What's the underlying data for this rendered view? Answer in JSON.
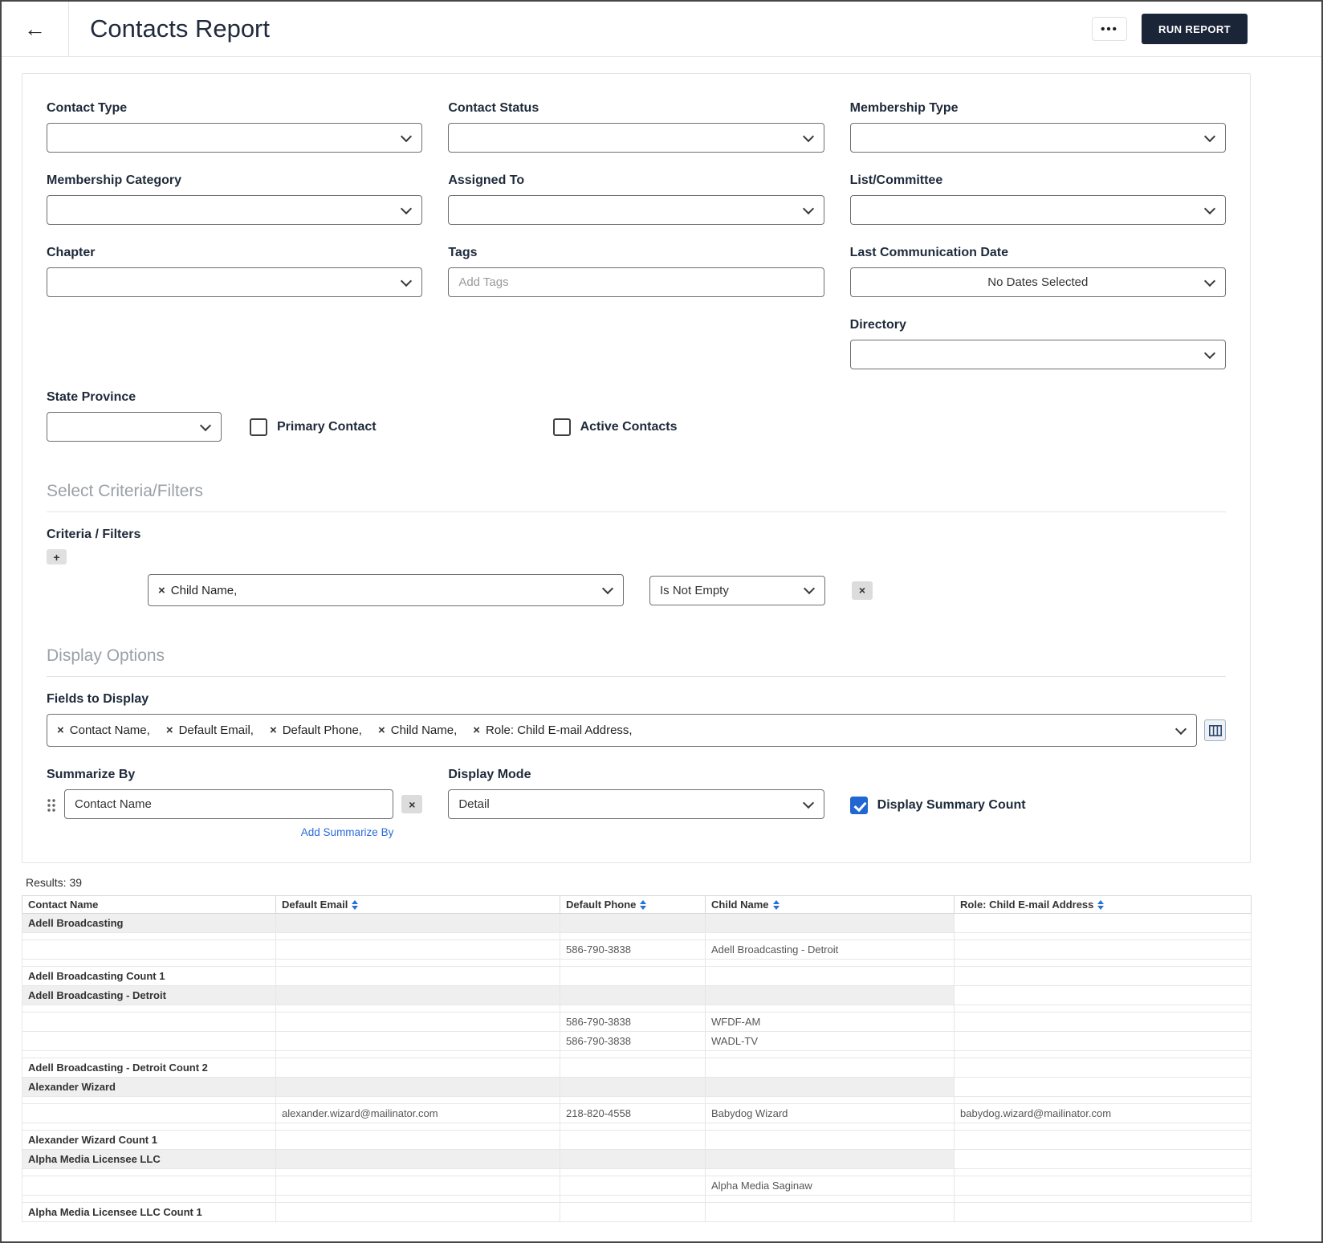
{
  "header": {
    "back_icon": "←",
    "title": "Contacts Report",
    "more_icon": "•••",
    "run_report_label": "RUN REPORT"
  },
  "icons": {
    "remove": "×"
  },
  "colors": {
    "accent_blue": "#2270d8",
    "run_button_bg": "#1b2538",
    "checkbox_checked": "#2166d1",
    "group_row_bg": "#efefef"
  },
  "filters": {
    "contact_type_label": "Contact Type",
    "contact_status_label": "Contact Status",
    "membership_type_label": "Membership Type",
    "membership_category_label": "Membership Category",
    "assigned_to_label": "Assigned To",
    "list_committee_label": "List/Committee",
    "chapter_label": "Chapter",
    "tags_label": "Tags",
    "tags_placeholder": "Add Tags",
    "last_communication_date_label": "Last Communication Date",
    "last_communication_date_value": "No Dates Selected",
    "directory_label": "Directory",
    "state_province_label": "State Province",
    "primary_contact_label": "Primary Contact",
    "primary_contact_checked": false,
    "active_contacts_label": "Active Contacts",
    "active_contacts_checked": false
  },
  "criteria": {
    "section_title": "Select Criteria/Filters",
    "label": "Criteria / Filters",
    "add_icon": "+",
    "row": {
      "field_token": "Child Name,",
      "operator": "Is Not Empty"
    }
  },
  "display_options": {
    "section_title": "Display Options",
    "fields_to_display_label": "Fields to Display",
    "field_tokens": [
      "Contact Name,",
      "Default Email,",
      "Default Phone,",
      "Child Name,",
      "Role: Child E-mail Address,"
    ],
    "summarize_by_label": "Summarize By",
    "summarize_value": "Contact Name",
    "add_summarize_link": "Add Summarize By",
    "display_mode_label": "Display Mode",
    "display_mode_value": "Detail",
    "summary_count_label": "Display Summary Count",
    "summary_count_checked": true
  },
  "results": {
    "count_label": "Results: 39",
    "columns": [
      {
        "label": "Contact Name",
        "sortable": false
      },
      {
        "label": "Default Email",
        "sortable": true
      },
      {
        "label": "Default Phone",
        "sortable": true
      },
      {
        "label": "Child Name",
        "sortable": true
      },
      {
        "label": "Role: Child E-mail Address",
        "sortable": true
      }
    ],
    "rows": [
      {
        "type": "group",
        "cells": [
          "Adell Broadcasting",
          "",
          "",
          "",
          ""
        ]
      },
      {
        "type": "spacer"
      },
      {
        "type": "detail",
        "cells": [
          "",
          "",
          "586-790-3838",
          "Adell Broadcasting - Detroit",
          ""
        ]
      },
      {
        "type": "spacer"
      },
      {
        "type": "count",
        "cells": [
          "Adell Broadcasting Count 1",
          "",
          "",
          "",
          ""
        ]
      },
      {
        "type": "group",
        "cells": [
          "Adell Broadcasting - Detroit",
          "",
          "",
          "",
          ""
        ]
      },
      {
        "type": "spacer"
      },
      {
        "type": "detail",
        "cells": [
          "",
          "",
          "586-790-3838",
          "WFDF-AM",
          ""
        ]
      },
      {
        "type": "detail",
        "cells": [
          "",
          "",
          "586-790-3838",
          "WADL-TV",
          ""
        ]
      },
      {
        "type": "spacer"
      },
      {
        "type": "count",
        "cells": [
          "Adell Broadcasting - Detroit Count 2",
          "",
          "",
          "",
          ""
        ]
      },
      {
        "type": "group",
        "cells": [
          "Alexander Wizard",
          "",
          "",
          "",
          ""
        ]
      },
      {
        "type": "spacer"
      },
      {
        "type": "detail",
        "cells": [
          "",
          "alexander.wizard@mailinator.com",
          "218-820-4558",
          "Babydog Wizard",
          "babydog.wizard@mailinator.com"
        ]
      },
      {
        "type": "spacer"
      },
      {
        "type": "count",
        "cells": [
          "Alexander Wizard Count 1",
          "",
          "",
          "",
          ""
        ]
      },
      {
        "type": "group",
        "cells": [
          "Alpha Media Licensee LLC",
          "",
          "",
          "",
          ""
        ]
      },
      {
        "type": "spacer"
      },
      {
        "type": "detail",
        "cells": [
          "",
          "",
          "",
          "Alpha Media Saginaw",
          ""
        ]
      },
      {
        "type": "spacer"
      },
      {
        "type": "count",
        "cells": [
          "Alpha Media Licensee LLC Count 1",
          "",
          "",
          "",
          ""
        ]
      }
    ]
  }
}
